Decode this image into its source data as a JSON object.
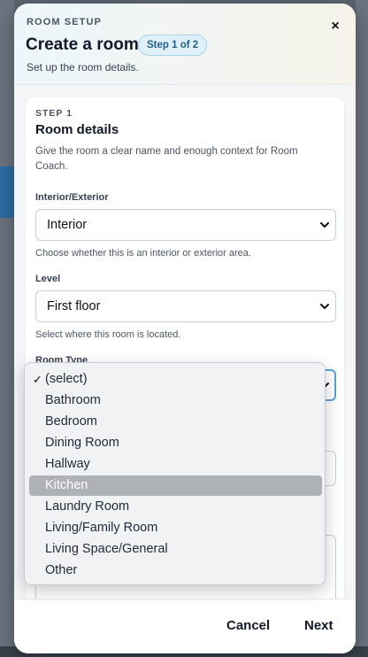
{
  "modal": {
    "eyebrow": "ROOM SETUP",
    "title": "Create a room",
    "step_pill": "Step 1 of 2",
    "subtitle": "Set up the room details.",
    "close_glyph": "×"
  },
  "card": {
    "step_label": "STEP 1",
    "section_title": "Room details",
    "section_desc": "Give the room a clear name and enough context for Room Coach."
  },
  "fields": {
    "interior_exterior": {
      "label": "Interior/Exterior",
      "value": "Interior",
      "help": "Choose whether this is an interior or exterior area."
    },
    "level": {
      "label": "Level",
      "value": "First floor",
      "help": "Select where this room is located."
    },
    "room_type": {
      "label": "Room Type"
    }
  },
  "dropdown": {
    "check_glyph": "✓",
    "options": [
      "(select)",
      "Bathroom",
      "Bedroom",
      "Dining Room",
      "Hallway",
      "Kitchen",
      "Laundry Room",
      "Living/Family Room",
      "Living Space/General",
      "Other"
    ],
    "checked": "(select)",
    "highlighted": "Kitchen"
  },
  "footer": {
    "cancel_label": "Cancel",
    "next_label": "Next"
  },
  "colors": {
    "focus_ring": "#5a9fd6",
    "pill_bg": "#dff0f8",
    "pill_text": "#1f5f86",
    "highlight": "#aeb1b6"
  }
}
